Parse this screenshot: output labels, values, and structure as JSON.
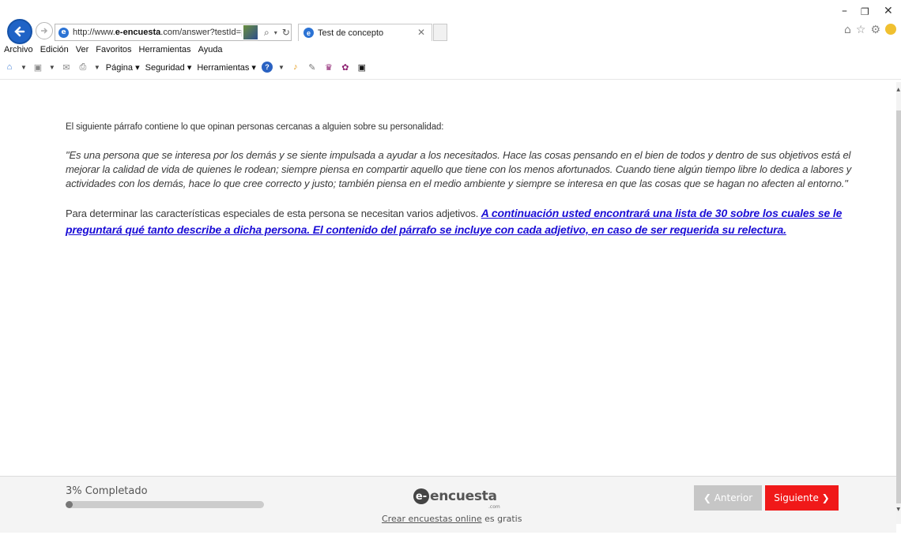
{
  "browser": {
    "address_url_prefix": "http://www.",
    "address_url_domain": "e-encuesta",
    "address_url_rest": ".com/answer?testId=pINL",
    "tab_title": "Test de concepto",
    "menu": [
      "Archivo",
      "Edición",
      "Ver",
      "Favoritos",
      "Herramientas",
      "Ayuda"
    ],
    "toolbar": {
      "pagina": "Página ▾",
      "seguridad": "Seguridad ▾",
      "herramientas": "Herramientas ▾"
    }
  },
  "page": {
    "intro": "El siguiente párrafo contiene lo que opinan personas cercanas a alguien sobre su personalidad:",
    "quote": "\"Es una persona que se interesa por los demás y se siente impulsada a ayudar a los necesitados. Hace las cosas pensando en el bien de todos y dentro de sus objetivos está el  mejorar la calidad de vida de quienes le rodean; siempre piensa en compartir aquello que tiene con los menos afortunados. Cuando tiene algún tiempo libre lo dedica a labores y actividades con los demás, hace lo que cree correcto y justo; también piensa en el medio ambiente y siempre se interesa en que las cosas que se hagan no afecten al entorno.\"",
    "para_text": "Para determinar las características especiales de esta persona se necesitan varios adjetivos. ",
    "para_link": "A continuación usted encontrará una lista de 30 sobre los cuales se le preguntará qué tanto describe a dicha persona. El contenido del párrafo se incluye con cada adjetivo, en caso de ser requerida su relectura."
  },
  "footer": {
    "progress_label": "3% Completado",
    "progress_fraction": 0.03,
    "logo_text": "encuesta",
    "logo_letter": "e-",
    "logo_com": ".com",
    "link_text": "Crear encuestas online",
    "link_suffix": " es gratis",
    "prev_label": "❮ Anterior",
    "next_label": "Siguiente ❯"
  },
  "colors": {
    "next_button": "#f01919",
    "prev_button": "#c6c6c6",
    "link": "#1a0dd6"
  }
}
